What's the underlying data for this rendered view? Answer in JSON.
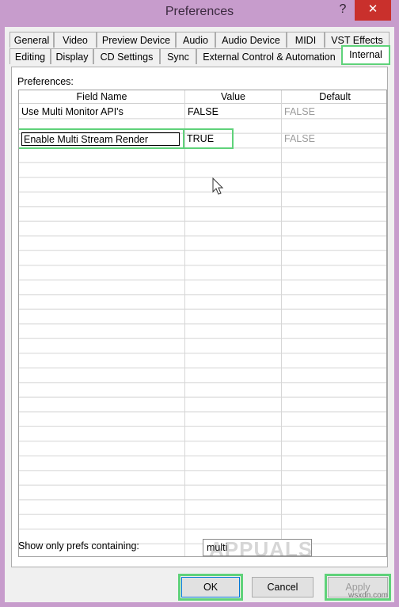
{
  "window": {
    "title": "Preferences",
    "help": "?",
    "close": "✕"
  },
  "tabs_row1": [
    "General",
    "Video",
    "Preview Device",
    "Audio",
    "Audio Device",
    "MIDI",
    "VST Effects"
  ],
  "tabs_row2": [
    "Editing",
    "Display",
    "CD Settings",
    "Sync",
    "External Control & Automation",
    "Internal"
  ],
  "active_tab": "Internal",
  "panel": {
    "label": "Preferences:",
    "columns": [
      "Field Name",
      "Value",
      "Default"
    ],
    "rows": [
      {
        "field": "Use Multi Monitor API's",
        "value": "FALSE",
        "default": "FALSE"
      },
      {
        "field": "Enable Multi Stream Render",
        "value": "TRUE",
        "default": "FALSE"
      }
    ]
  },
  "filter": {
    "label": "Show only prefs containing:",
    "value": "multi"
  },
  "watermark": "APPUALS",
  "buttons": {
    "ok": "OK",
    "cancel": "Cancel",
    "apply": "Apply"
  },
  "site": "wsxdn.com",
  "colors": {
    "titlebar": "#c79ccc",
    "close": "#c9302c",
    "highlight": "#5fd27a"
  }
}
